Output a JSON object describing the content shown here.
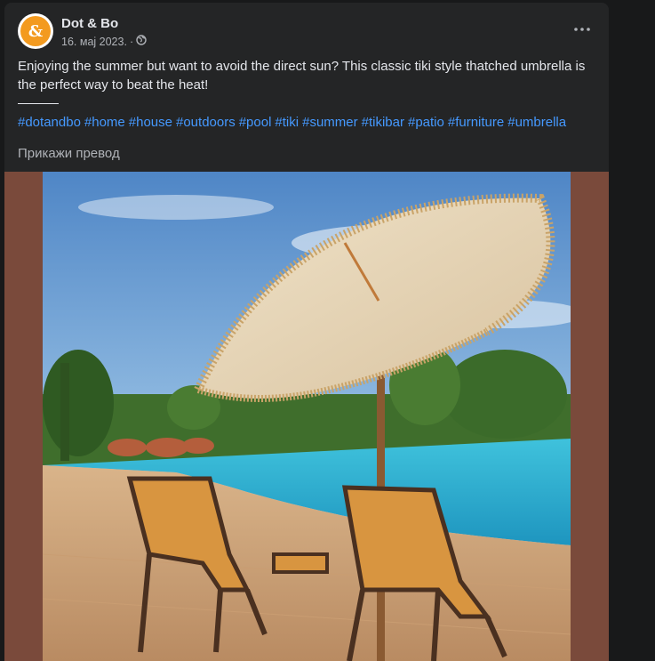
{
  "post": {
    "author": "Dot & Bo",
    "date": "16. мај 2023.",
    "separator": "·",
    "body_text": "Enjoying the summer but want to avoid the direct sun?  This classic tiki style thatched umbrella is the perfect way to beat the heat!",
    "hashtags": [
      "#dotandbo",
      "#home",
      "#house",
      "#outdoors",
      "#pool",
      "#tiki",
      "#summer",
      "#tikibar",
      "#patio",
      "#furniture",
      "#umbrella"
    ],
    "translate_label": "Прикажи превод"
  },
  "colors": {
    "page_bg": "#18191a",
    "card_bg": "#242526",
    "text_primary": "#e4e6eb",
    "text_secondary": "#b0b3b8",
    "link": "#4599ff",
    "brand_orange": "#f39a1f",
    "media_border": "#7a4a3b"
  },
  "icons": {
    "avatar": "dot-and-bo-logo",
    "privacy": "globe-icon",
    "menu": "more-horizontal-icon"
  }
}
